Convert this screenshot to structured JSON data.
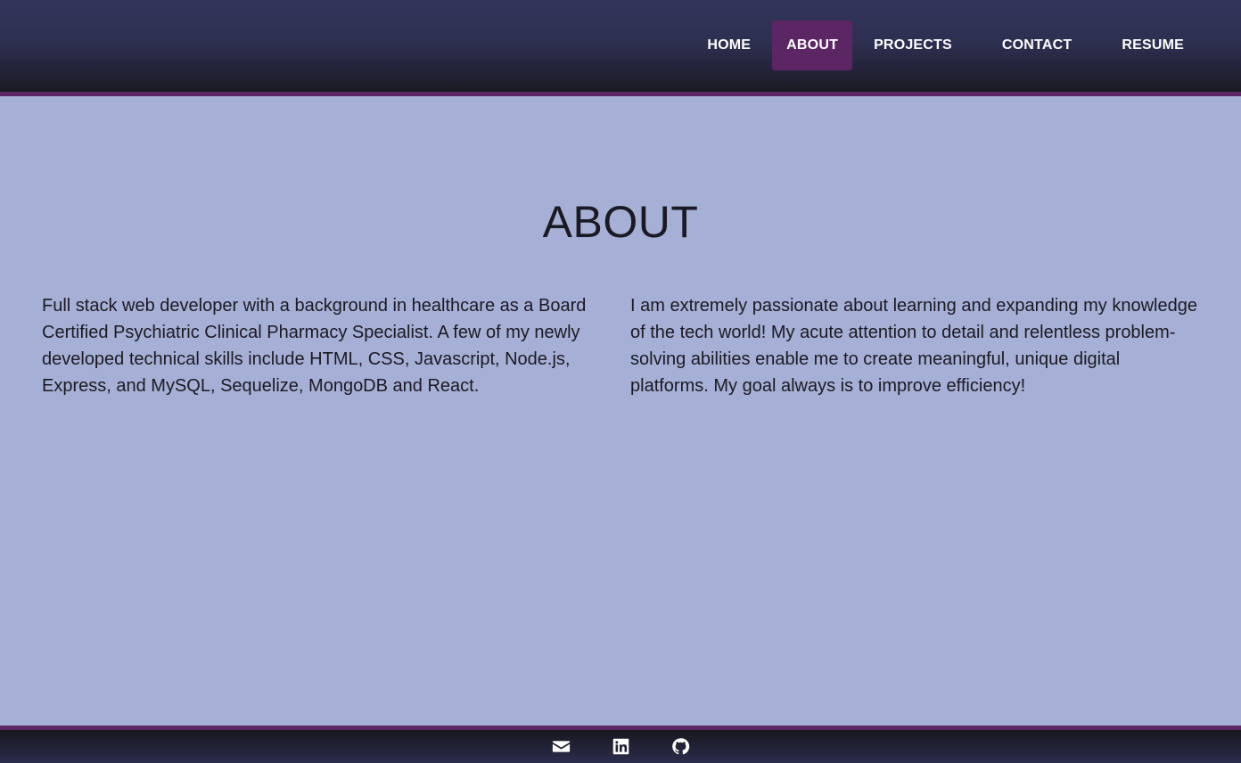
{
  "nav": {
    "items": [
      {
        "label": "HOME",
        "active": false
      },
      {
        "label": "ABOUT",
        "active": true
      },
      {
        "label": "PROJECTS",
        "active": false
      },
      {
        "label": "CONTACT",
        "active": false
      },
      {
        "label": "RESUME",
        "active": false
      }
    ]
  },
  "main": {
    "title": "ABOUT",
    "paragraph_left": "Full stack web developer with a background in healthcare as a Board Certified Psychiatric Clinical Pharmacy Specialist. A few of my newly developed technical skills include HTML, CSS, Javascript, Node.js, Express, and MySQL, Sequelize, MongoDB and React.",
    "paragraph_right": "I am extremely passionate about learning and expanding my knowledge of the tech world! My acute attention to detail and relentless problem-solving abilities enable me to create meaningful, unique digital platforms. My goal always is to improve efficiency!"
  },
  "footer": {
    "icons": [
      "envelope-icon",
      "linkedin-icon",
      "github-icon"
    ]
  },
  "colors": {
    "background": "#a6b0d6",
    "navbar": "#323459",
    "accent": "#5c2563",
    "text": "#1b1a22"
  }
}
